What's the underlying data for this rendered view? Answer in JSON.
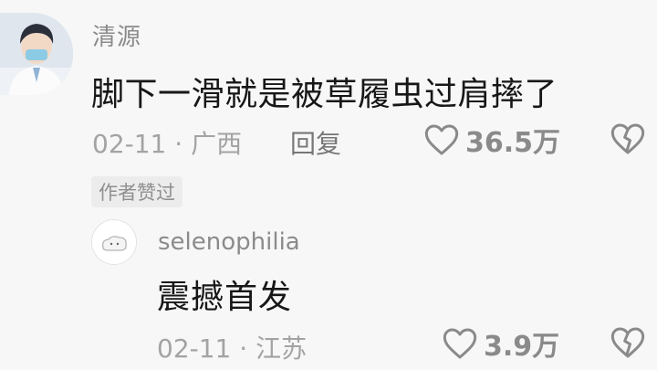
{
  "comment": {
    "username": "清源",
    "text": "脚下一滑就是被草履虫过肩摔了",
    "date": "02-11",
    "location": "广西",
    "separator": "·",
    "reply_label": "回复",
    "like_count": "36.5万",
    "author_badge": "作者赞过"
  },
  "reply": {
    "username": "selenophilia",
    "text": "震撼首发",
    "date": "02-11",
    "location": "江苏",
    "separator": "·",
    "like_count": "3.9万"
  },
  "icons": {
    "like": "heart-outline-icon",
    "dislike": "broken-heart-icon"
  },
  "colors": {
    "background": "#f7f7f7",
    "text": "#171717",
    "muted": "#a3a3a3"
  }
}
